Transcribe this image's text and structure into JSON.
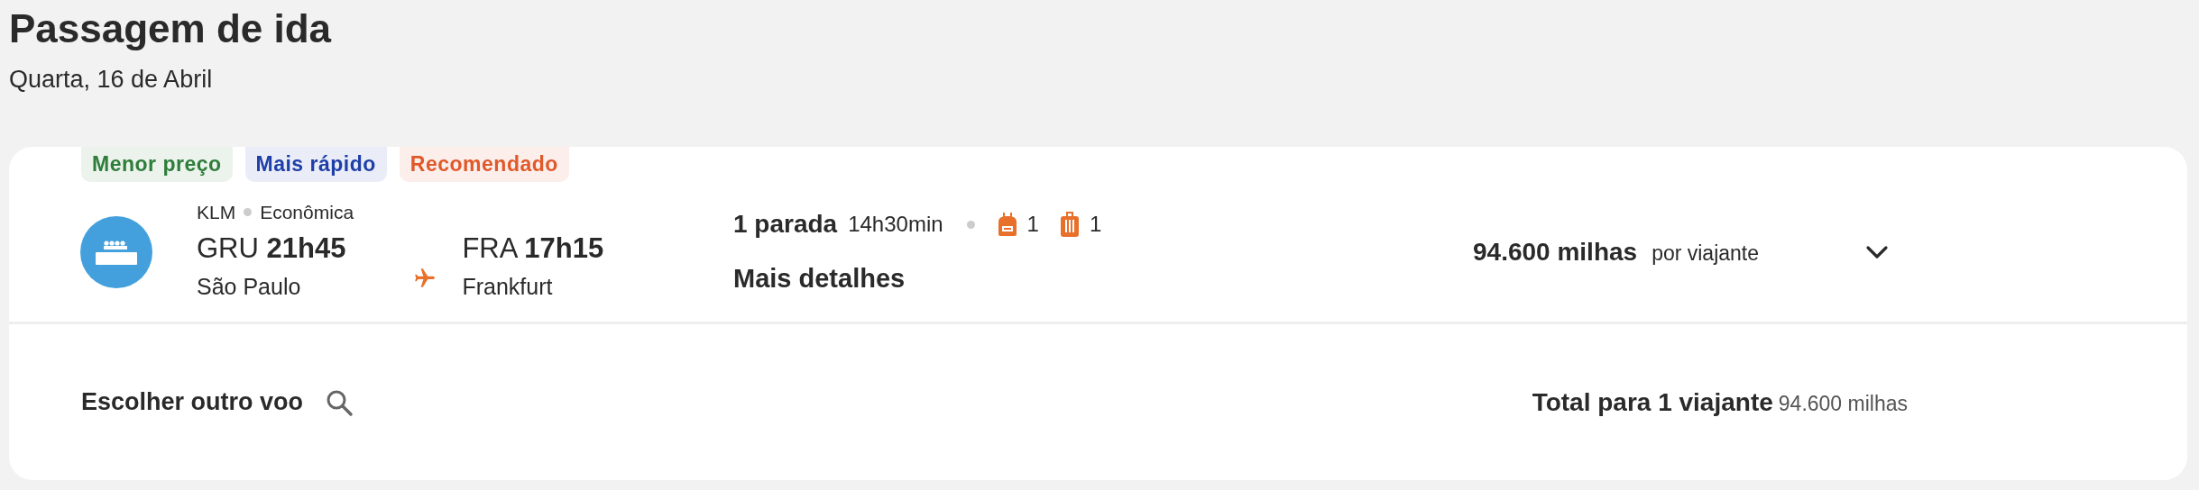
{
  "header": {
    "title": "Passagem de ida",
    "date": "Quarta, 16 de Abril"
  },
  "tags": [
    {
      "label": "Menor preço",
      "color": "#2e7d3a"
    },
    {
      "label": "Mais rápido",
      "color": "#1f3fa8"
    },
    {
      "label": "Recomendado",
      "color": "#e0592a"
    }
  ],
  "flight": {
    "airline": "KLM",
    "cabin": "Econômica",
    "origin": {
      "code": "GRU",
      "time": "21h45",
      "city": "São Paulo"
    },
    "destination": {
      "code": "FRA",
      "time": "17h15",
      "city": "Frankfurt"
    },
    "stops": "1 parada",
    "duration": "14h30min",
    "backpack": "1",
    "suitcase": "1",
    "details_link": "Mais detalhes",
    "price": "94.600 milhas",
    "price_note": "por viajante",
    "expanded": false
  },
  "footer": {
    "change_flight": "Escolher outro voo",
    "total_label": "Total para 1 viajante",
    "total_value": "94.600 milhas"
  }
}
